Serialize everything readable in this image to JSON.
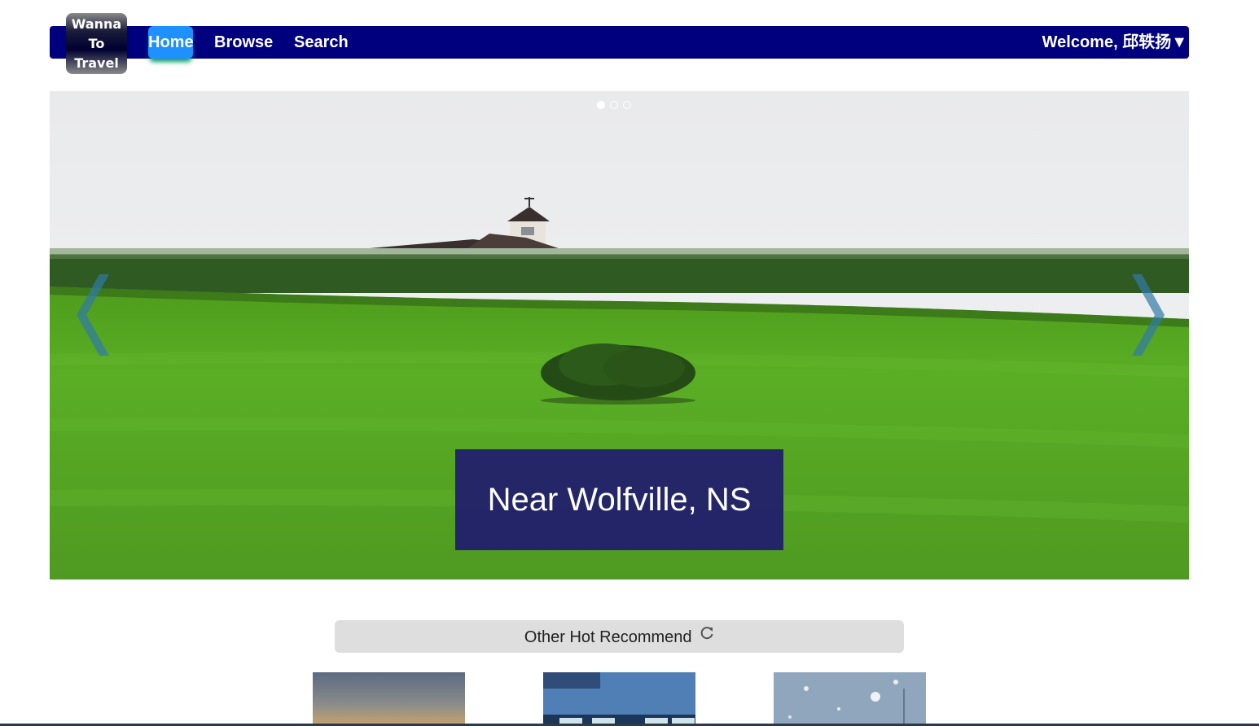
{
  "logo": {
    "line1": "Wanna",
    "line2": "To",
    "line3": "Travel"
  },
  "nav": {
    "home": "Home",
    "browse": "Browse",
    "search": "Search",
    "welcome": "Welcome, 邱轶扬▼"
  },
  "carousel": {
    "caption": "Near Wolfville, NS",
    "slides_total": 3,
    "active_slide": 1,
    "prev_icon": "chevron-left-icon",
    "next_icon": "chevron-right-icon"
  },
  "recommend": {
    "title": "Other Hot Recommend",
    "refresh_icon": "refresh-icon"
  },
  "colors": {
    "navbar": "#00007f",
    "home_active": "#1e90ff",
    "caption_bg": "#201c6e",
    "recommend_bar": "#dedede"
  }
}
